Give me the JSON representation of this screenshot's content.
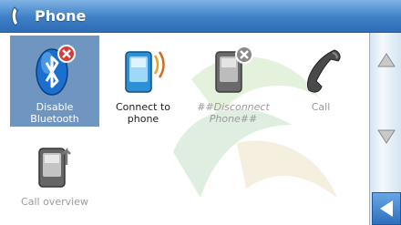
{
  "window": {
    "title": "Phone",
    "icon": "phone-handset-icon"
  },
  "tiles": [
    {
      "lines": [
        "Disable",
        "Bluetooth"
      ],
      "icon": "bluetooth-icon",
      "state": "selected"
    },
    {
      "lines": [
        "Connect to",
        "phone"
      ],
      "icon": "phone-connect-icon",
      "state": "normal"
    },
    {
      "lines": [
        "##Disconnect",
        "Phone##"
      ],
      "icon": "phone-disconnect-icon",
      "state": "disabled"
    },
    {
      "lines": [
        "Call"
      ],
      "icon": "handset-icon",
      "state": "dim"
    },
    {
      "lines": [
        "Call overview"
      ],
      "icon": "call-overview-icon",
      "state": "dim"
    }
  ],
  "scrollbar": {
    "up": "scroll-up-icon",
    "down": "scroll-down-icon"
  },
  "back": {
    "icon": "back-arrow-icon"
  },
  "colors": {
    "titlebar": "#3d7fc6",
    "selected": "#6f95c1",
    "scrollbar": "#d5e4f3"
  }
}
